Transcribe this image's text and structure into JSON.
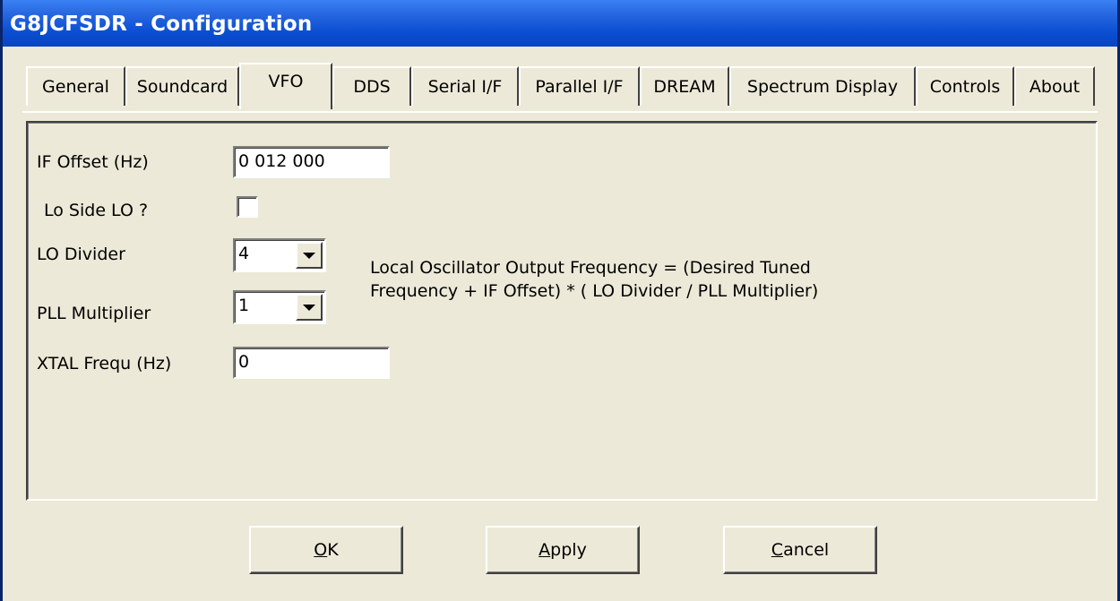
{
  "window": {
    "title": "G8JCFSDR - Configuration"
  },
  "tabs": [
    {
      "label": "General"
    },
    {
      "label": "Soundcard"
    },
    {
      "label": "VFO"
    },
    {
      "label": "DDS"
    },
    {
      "label": "Serial I/F"
    },
    {
      "label": "Parallel I/F"
    },
    {
      "label": "DREAM"
    },
    {
      "label": "Spectrum Display"
    },
    {
      "label": "Controls"
    },
    {
      "label": "About"
    }
  ],
  "active_tab": "VFO",
  "form": {
    "if_offset_label": "IF Offset (Hz)",
    "if_offset_value": "0 012 000",
    "lo_side_label": "Lo Side LO ?",
    "lo_side_checked": false,
    "lo_divider_label": "LO Divider",
    "lo_divider_value": "4",
    "pll_multiplier_label": "PLL Multiplier",
    "pll_multiplier_value": "1",
    "xtal_label": "XTAL Frequ (Hz)",
    "xtal_value": "0",
    "formula_line1": "Local Oscillator Output Frequency = (Desired Tuned",
    "formula_line2": "Frequency + IF Offset) * ( LO Divider / PLL Multiplier)"
  },
  "buttons": {
    "ok_mnemonic": "O",
    "ok_rest": "K",
    "apply_mnemonic": "A",
    "apply_rest": "pply",
    "cancel_mnemonic": "C",
    "cancel_rest": "ancel"
  }
}
